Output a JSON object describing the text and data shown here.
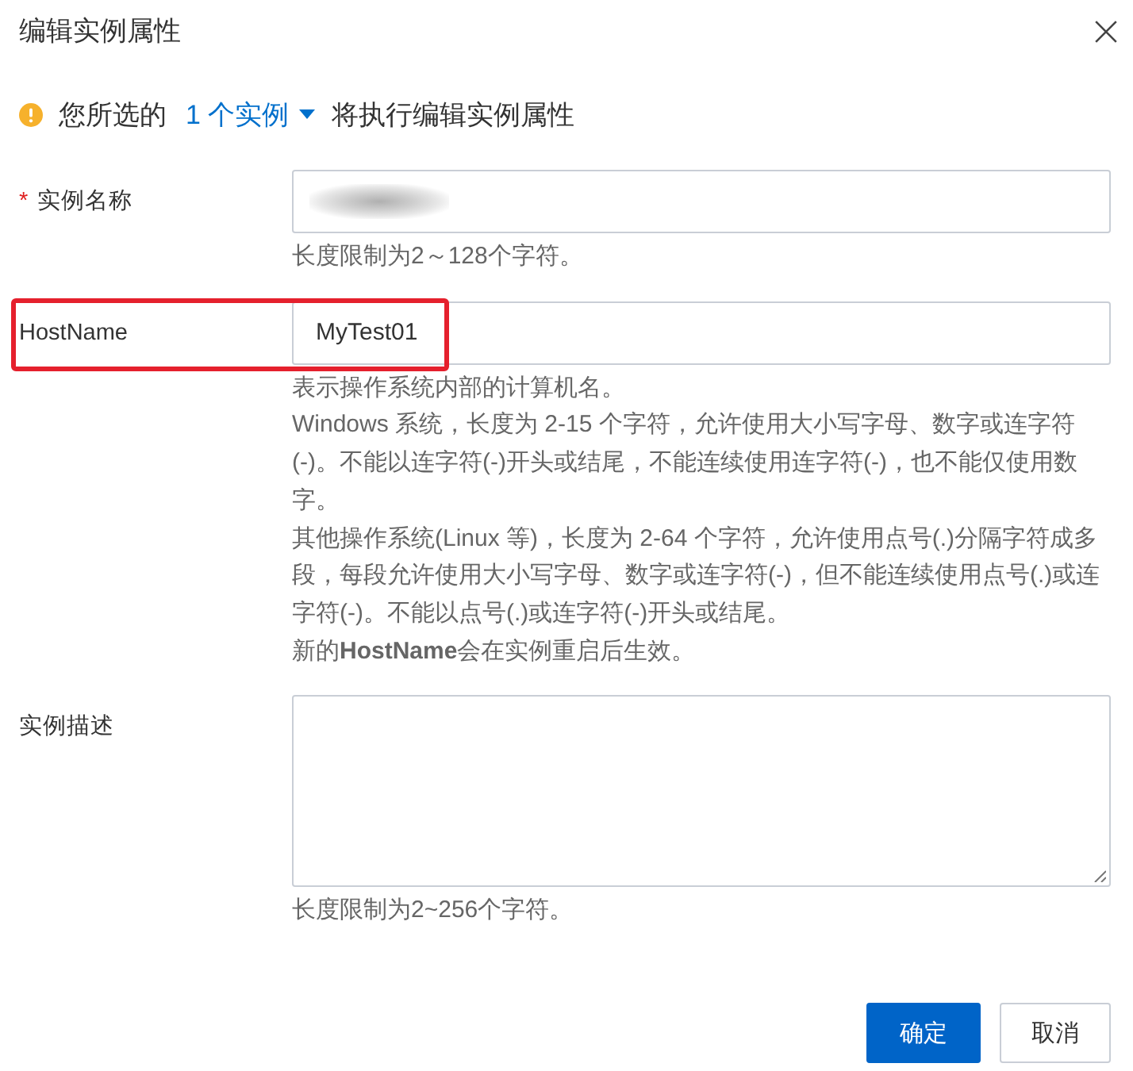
{
  "dialog": {
    "title": "编辑实例属性"
  },
  "notice": {
    "prefix": "您所选的",
    "link": "1 个实例",
    "suffix": "将执行编辑实例属性"
  },
  "fields": [
    {
      "label": "实例名称",
      "required_mark": "*",
      "kind": "input",
      "redacted": true,
      "highlighted": false,
      "hint": [
        "长度限制为2～128个字符。"
      ]
    },
    {
      "label": "HostName",
      "kind": "input",
      "value": "MyTest01",
      "redacted": false,
      "highlighted": true,
      "hint": [
        "表示操作系统内部的计算机名。",
        "Windows 系统，长度为 2-15 个字符，允许使用大小写字母、数字或连字符(-)。不能以连字符(-)开头或结尾，不能连续使用连字符(-)，也不能仅使用数字。",
        "其他操作系统(Linux 等)，长度为 2-64 个字符，允许使用点号(.)分隔字符成多段，每段允许使用大小写字母、数字或连字符(-)，但不能连续使用点号(.)或连字符(-)。不能以点号(.)或连字符(-)开头或结尾。",
        "新的**HostName**会在实例重启后生效。"
      ]
    },
    {
      "label": "实例描述",
      "kind": "textarea",
      "redacted": false,
      "highlighted": false,
      "hint": [
        "长度限制为2~256个字符。"
      ]
    }
  ],
  "buttons": [
    {
      "label": "确定",
      "kind": "primary"
    },
    {
      "label": "取消",
      "kind": "default"
    }
  ]
}
